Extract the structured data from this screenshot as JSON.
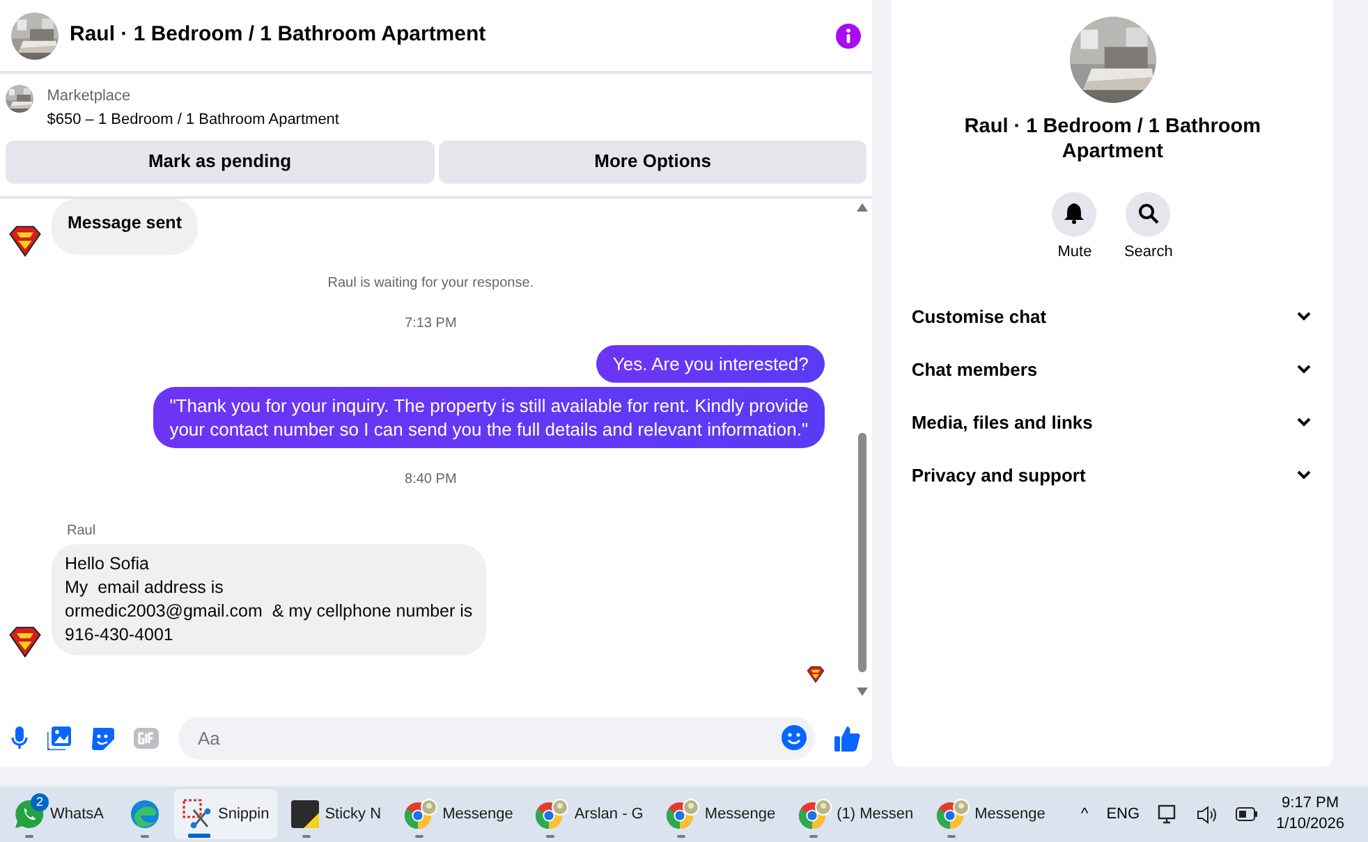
{
  "chat_header": {
    "title": "Raul · 1 Bedroom / 1 Bathroom Apartment"
  },
  "listing": {
    "source": "Marketplace",
    "summary": "$650 – 1 Bedroom / 1 Bathroom Apartment",
    "buttons": [
      "Mark as pending",
      "More Options"
    ]
  },
  "messages": [
    {
      "kind": "incoming",
      "lines": [
        "Message sent"
      ],
      "emphasis": true
    },
    {
      "kind": "notice",
      "text": "Raul is waiting for your response."
    },
    {
      "kind": "timestamp",
      "text": "7:13 PM"
    },
    {
      "kind": "outgoing",
      "lines": [
        "Yes. Are you interested?"
      ]
    },
    {
      "kind": "outgoing",
      "lines": [
        "\"Thank you for your inquiry. The property is still available for rent. Kindly provide",
        "your contact number so I can send you the full details and relevant information.\""
      ]
    },
    {
      "kind": "timestamp",
      "text": "8:40 PM"
    },
    {
      "kind": "incoming",
      "sender": "Raul",
      "lines": [
        "Hello Sofia",
        "My  email address is",
        "ormedic2003@gmail.com  & my cellphone number is",
        "916-430-4001"
      ],
      "emphasis": false
    }
  ],
  "composer": {
    "placeholder": "Aa"
  },
  "details": {
    "title": "Raul · 1 Bedroom / 1 Bathroom Apartment",
    "actions": [
      {
        "kind": "bell",
        "label": "Mute"
      },
      {
        "kind": "search",
        "label": "Search"
      }
    ],
    "sections": [
      {
        "label": "Customise chat",
        "expanded": false
      },
      {
        "label": "Chat members",
        "expanded": false
      },
      {
        "label": "Media, files and links",
        "expanded": false
      },
      {
        "label": "Privacy and support",
        "expanded": false
      }
    ]
  },
  "taskbar": {
    "apps": [
      {
        "kind": "whatsapp",
        "label": "WhatsA",
        "badge": "2",
        "selected": false
      },
      {
        "kind": "edge",
        "selected": false
      },
      {
        "kind": "snipping",
        "label": "Snippin",
        "selected": true
      },
      {
        "kind": "sticky",
        "label": "Sticky N",
        "selected": false
      },
      {
        "kind": "chrome",
        "label": "Messenge",
        "selected": false
      },
      {
        "kind": "chrome",
        "label": "Arslan - G",
        "selected": false
      },
      {
        "kind": "chrome",
        "label": "Messenge",
        "selected": false
      },
      {
        "kind": "chrome",
        "label": "(1) Messen",
        "selected": false
      },
      {
        "kind": "chrome",
        "label": "Messenge",
        "selected": false
      }
    ],
    "tray": {
      "overflow": "^",
      "language": "ENG",
      "time": "9:17 PM",
      "date": "1/10/2026"
    }
  }
}
